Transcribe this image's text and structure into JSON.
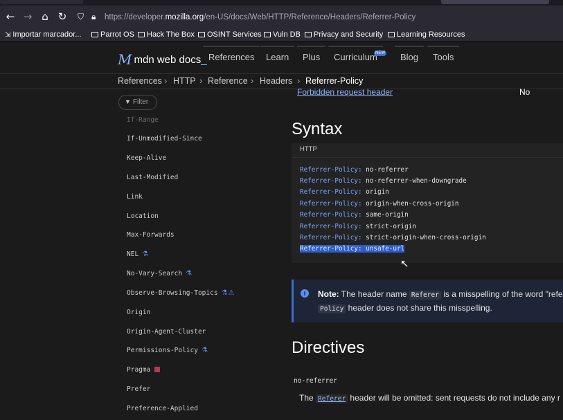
{
  "browser": {
    "url_prefix": "https://developer.",
    "url_domain": "mozilla.org",
    "url_path": "/en-US/docs/Web/HTTP/Reference/Headers/Referrer-Policy",
    "bookmarks": [
      "Importar marcador...",
      "Parrot OS",
      "Hack The Box",
      "OSINT Services",
      "Vuln DB",
      "Privacy and Security",
      "Learning Resources"
    ]
  },
  "header": {
    "logo_text": "mdn web docs",
    "nav": [
      "References",
      "Learn",
      "Plus",
      "Curriculum",
      "Blog",
      "Tools"
    ],
    "new_badge": "NEW"
  },
  "breadcrumb": [
    "References",
    "HTTP",
    "Reference",
    "Headers",
    "Referrer-Policy"
  ],
  "sidebar": {
    "filter_placeholder": "Filter",
    "items": [
      "If-Range",
      "If-Unmodified-Since",
      "Keep-Alive",
      "Last-Modified",
      "Link",
      "Location",
      "Max-Forwards",
      "NEL",
      "No-Vary-Search",
      "Observe-Browsing-Topics",
      "Origin",
      "Origin-Agent-Cluster",
      "Permissions-Policy",
      "Pragma",
      "Prefer",
      "Preference-Applied"
    ]
  },
  "main": {
    "forbidden_link": "Forbidden request header",
    "forbidden_value": "No",
    "syntax_heading": "Syntax",
    "code_label": "HTTP",
    "code_key": "Referrer-Policy:",
    "code_values": [
      "no-referrer",
      "no-referrer-when-downgrade",
      "origin",
      "origin-when-cross-origin",
      "same-origin",
      "strict-origin",
      "strict-origin-when-cross-origin",
      "unsafe-url"
    ],
    "note": {
      "label": "Note:",
      "text_a": "The header name",
      "code_a": "Referer",
      "text_b": "is a misspelling of the word \"refer",
      "code_b": "Policy",
      "text_c": "header does not share this misspelling."
    },
    "directives_heading": "Directives",
    "directive_term": "no-referrer",
    "directive_text_a": "The",
    "directive_code": "Referer",
    "directive_text_b": "header will be omitted: sent requests do not include any r"
  }
}
